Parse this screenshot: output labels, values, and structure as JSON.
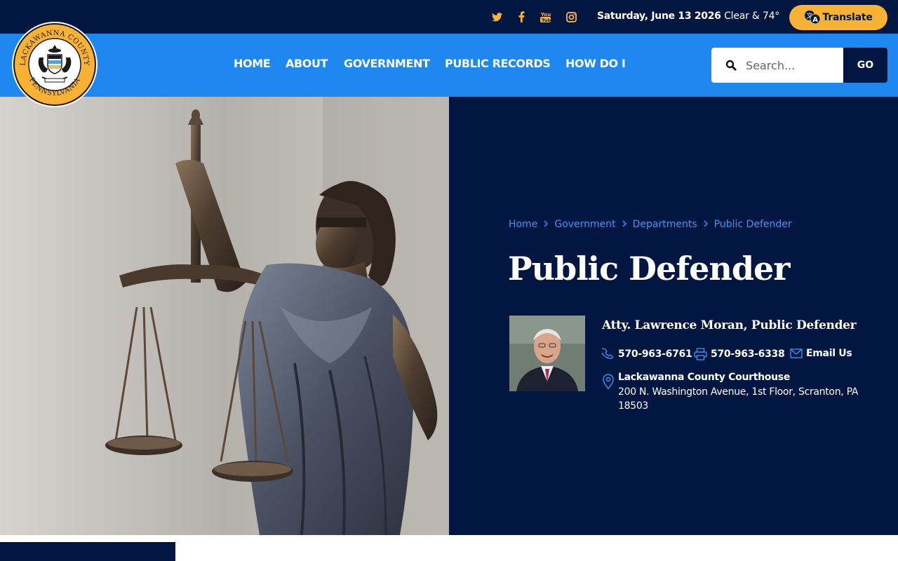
{
  "topbar": {
    "social": [
      {
        "name": "twitter-icon",
        "color": "#f9b233"
      },
      {
        "name": "facebook-icon",
        "color": "#f9b233"
      },
      {
        "name": "youtube-icon",
        "color": "#f9b233"
      },
      {
        "name": "instagram-icon",
        "color": "#f9b233"
      }
    ],
    "date": "Saturday, June 13 2026",
    "weather": "Clear & 74°",
    "translate_label": "Translate"
  },
  "header": {
    "seal": {
      "top_text": "LACKAWANNA COUNTY",
      "bottom_text": "PENNSYLVANIA"
    },
    "nav": [
      {
        "label": "HOME"
      },
      {
        "label": "ABOUT"
      },
      {
        "label": "GOVERNMENT"
      },
      {
        "label": "PUBLIC RECORDS"
      },
      {
        "label": "HOW DO I"
      }
    ],
    "search": {
      "placeholder": "Search...",
      "value": "",
      "button_label": "GO"
    }
  },
  "hero": {
    "breadcrumb": [
      {
        "label": "Home"
      },
      {
        "label": "Government"
      },
      {
        "label": "Departments"
      },
      {
        "label": "Public Defender"
      }
    ],
    "title": "Public Defender",
    "contact": {
      "name": "Atty. Lawrence Moran, Public Defender",
      "phone": "570-963-6761",
      "fax": "570-963-6338",
      "email_label": "Email Us",
      "address_title": "Lackawanna County Courthouse",
      "address_line": "200 N. Washington Avenue, 1st Floor, Scranton, PA 18503"
    }
  },
  "colors": {
    "navy": "#011640",
    "nav_blue": "#1e88f0",
    "accent_gold": "#f9b233",
    "link_blue": "#3d96f5"
  }
}
